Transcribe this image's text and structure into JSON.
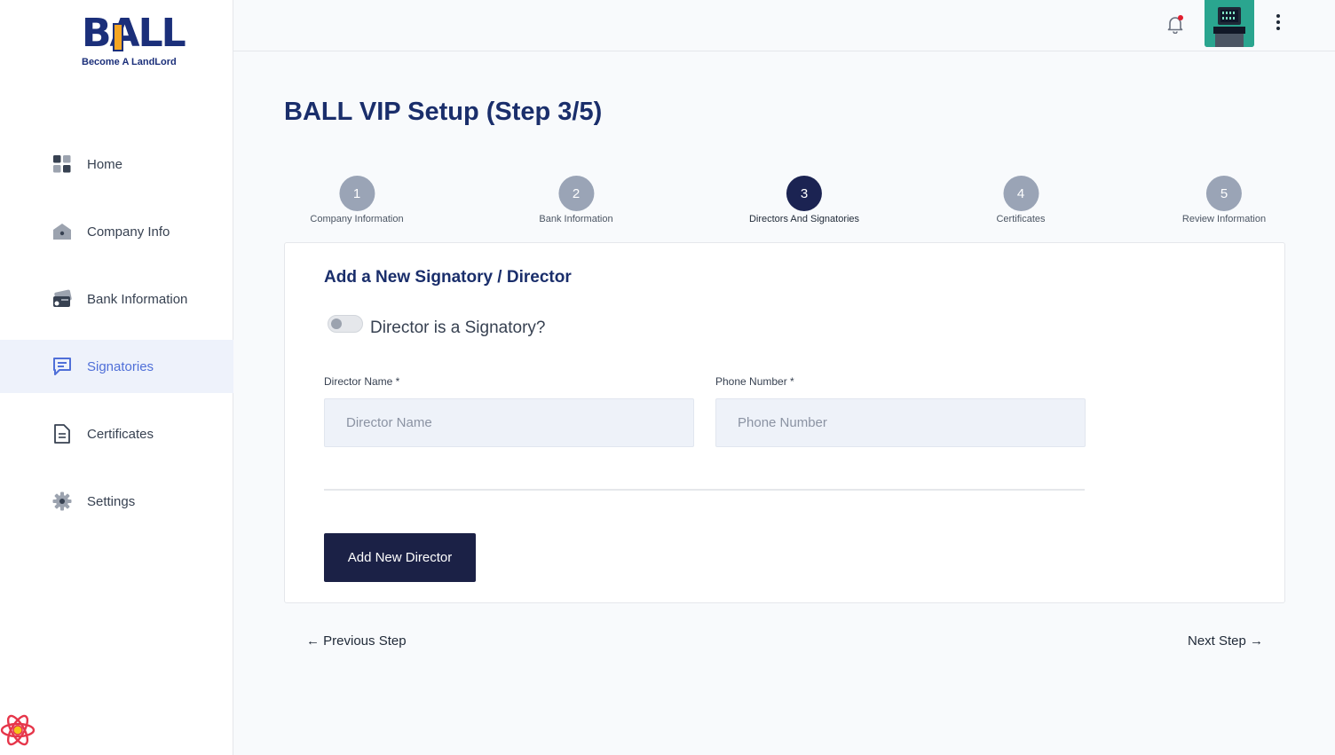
{
  "brand": {
    "logo_text": "BALL",
    "tagline": "Become A LandLord",
    "primary": "#1b2f7a",
    "accent": "#f5a623"
  },
  "sidebar": {
    "items": [
      {
        "label": "Home",
        "icon": "grid-icon",
        "active": false
      },
      {
        "label": "Company Info",
        "icon": "home-icon",
        "active": false
      },
      {
        "label": "Bank Information",
        "icon": "bank-card-icon",
        "active": false
      },
      {
        "label": "Signatories",
        "icon": "chat-icon",
        "active": true
      },
      {
        "label": "Certificates",
        "icon": "document-icon",
        "active": false
      },
      {
        "label": "Settings",
        "icon": "gear-icon",
        "active": false
      }
    ]
  },
  "header": {
    "notification_icon": "bell-icon",
    "has_unread": true,
    "menu_icon": "kebab-icon"
  },
  "page": {
    "title": "BALL VIP Setup (Step 3/5)"
  },
  "stepper": {
    "steps": [
      {
        "number": "1",
        "label": "Company Information"
      },
      {
        "number": "2",
        "label": "Bank Information"
      },
      {
        "number": "3",
        "label": "Directors And Signatories",
        "active": true
      },
      {
        "number": "4",
        "label": "Certificates"
      },
      {
        "number": "5",
        "label": "Review Information"
      }
    ]
  },
  "form": {
    "title": "Add a New Signatory / Director",
    "toggle_label": "Director is a Signatory?",
    "toggle_on": false,
    "director_name": {
      "label": "Director Name *",
      "placeholder": "Director Name",
      "value": ""
    },
    "phone_number": {
      "label": "Phone Number *",
      "placeholder": "Phone Number",
      "value": ""
    },
    "add_button": "Add New Director"
  },
  "footer_nav": {
    "previous": "← Previous Step",
    "next": "Next Step →"
  }
}
